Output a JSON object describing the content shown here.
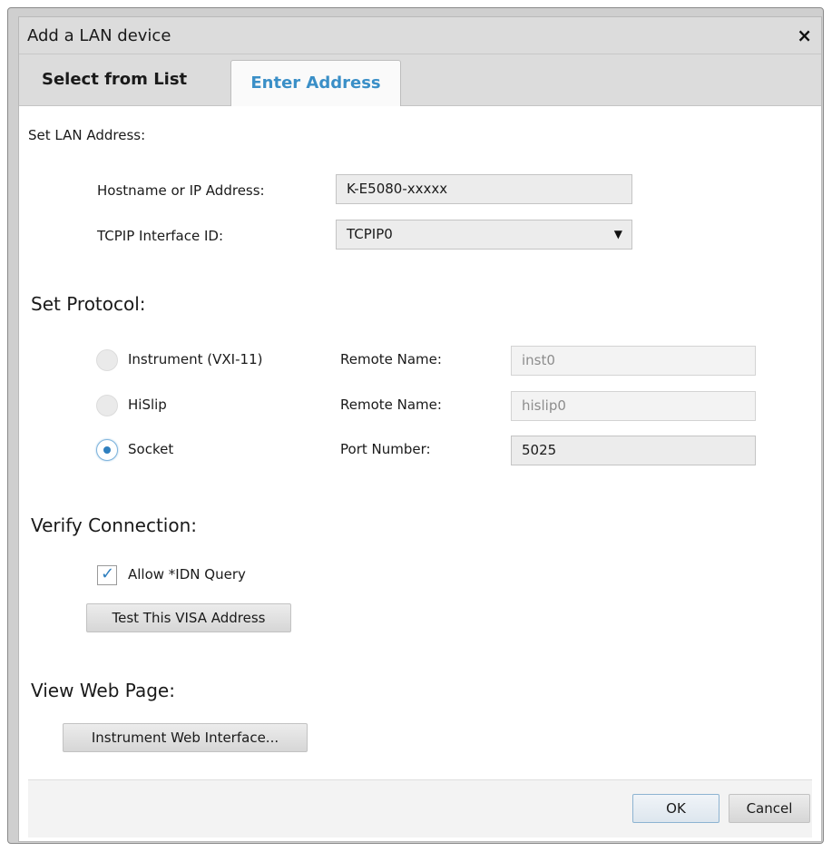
{
  "dialog": {
    "title": "Add a LAN device",
    "close_symbol": "×"
  },
  "tabs": [
    {
      "label": "Select from List",
      "active": false
    },
    {
      "label": "Enter Address",
      "active": true
    }
  ],
  "lan": {
    "section_label": "Set LAN Address:",
    "hostname_label": "Hostname or IP Address:",
    "hostname_value": "K-E5080-xxxxx",
    "interface_label": "TCPIP Interface ID:",
    "interface_value": "TCPIP0"
  },
  "protocol": {
    "header": "Set Protocol:",
    "options": [
      {
        "label": "Instrument (VXI-11)",
        "field_label": "Remote Name:",
        "field_value": "inst0",
        "selected": false
      },
      {
        "label": "HiSlip",
        "field_label": "Remote Name:",
        "field_value": "hislip0",
        "selected": false
      },
      {
        "label": "Socket",
        "field_label": "Port Number:",
        "field_value": "5025",
        "selected": true
      }
    ]
  },
  "verify": {
    "header": "Verify Connection:",
    "checkbox_label": "Allow *IDN Query",
    "checkbox_checked": true,
    "test_button": "Test This VISA Address"
  },
  "web": {
    "header": "View Web Page:",
    "button": "Instrument Web Interface..."
  },
  "footer": {
    "ok": "OK",
    "cancel": "Cancel"
  },
  "colors": {
    "accent": "#3a8fc7",
    "titlebar": "#dcdcdc"
  }
}
